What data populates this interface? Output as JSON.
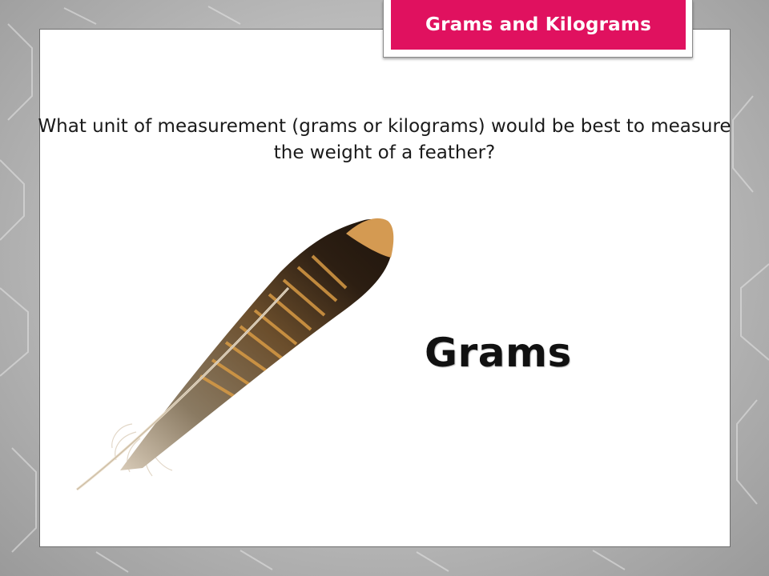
{
  "slide": {
    "title": "Grams and Kilograms",
    "question": "What unit of measurement (grams or kilograms) would be best to measure the weight of a feather?",
    "answer": "Grams"
  },
  "colors": {
    "title_bar": "#e0115f",
    "title_text": "#ffffff",
    "slide_bg": "#ffffff",
    "frame_bg": "#b9b9b9"
  },
  "icons": {
    "feather": "feather-icon"
  }
}
